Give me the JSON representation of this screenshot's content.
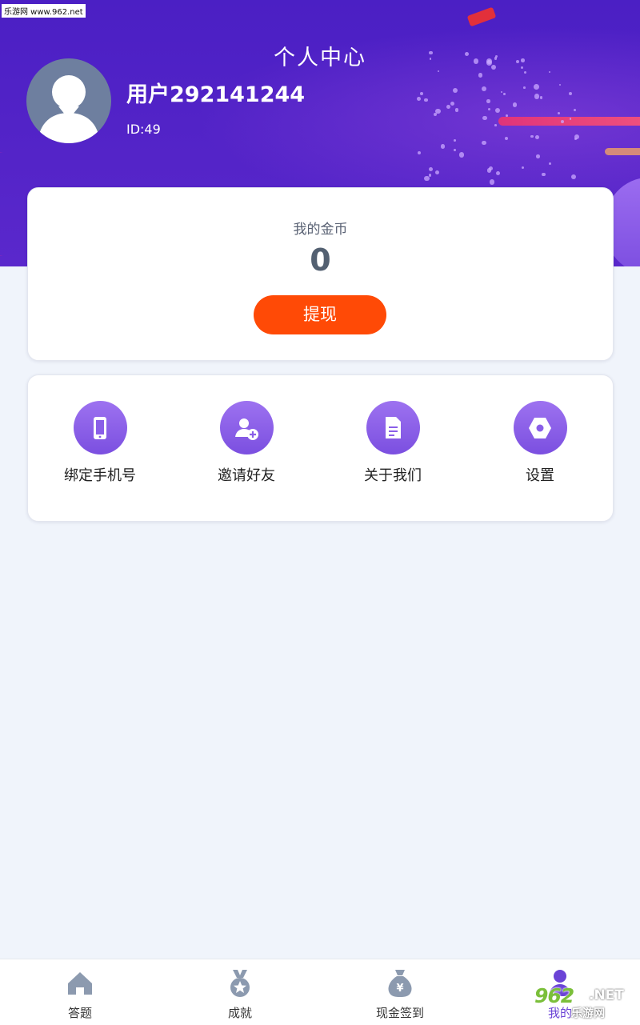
{
  "watermark": {
    "top_left": "乐游网 www.962.net",
    "bottom_right_main": "962",
    "bottom_right_suffix": ".NET",
    "bottom_right_cn": "乐游网"
  },
  "header": {
    "title": "个人中心"
  },
  "user": {
    "name": "用户292141244",
    "id_text": "ID:49",
    "avatar_icon": "person-silhouette-icon"
  },
  "coins": {
    "label": "我的金币",
    "value": "0",
    "withdraw_label": "提现",
    "withdraw_color": "#ff4a06"
  },
  "menu": {
    "items": [
      {
        "label": "绑定手机号",
        "icon": "phone-icon"
      },
      {
        "label": "邀请好友",
        "icon": "add-user-icon"
      },
      {
        "label": "关于我们",
        "icon": "document-icon"
      },
      {
        "label": "设置",
        "icon": "settings-hexagon-icon"
      }
    ]
  },
  "tabbar": {
    "items": [
      {
        "label": "答题",
        "icon": "home-icon",
        "active": false
      },
      {
        "label": "成就",
        "icon": "medal-icon",
        "active": false
      },
      {
        "label": "现金签到",
        "icon": "money-bag-icon",
        "active": false
      },
      {
        "label": "我的",
        "icon": "profile-icon",
        "active": true
      }
    ]
  },
  "colors": {
    "header_bg": "#5424c8",
    "accent_purple": "#7b4fe0",
    "page_bg": "#f0f4fb"
  }
}
